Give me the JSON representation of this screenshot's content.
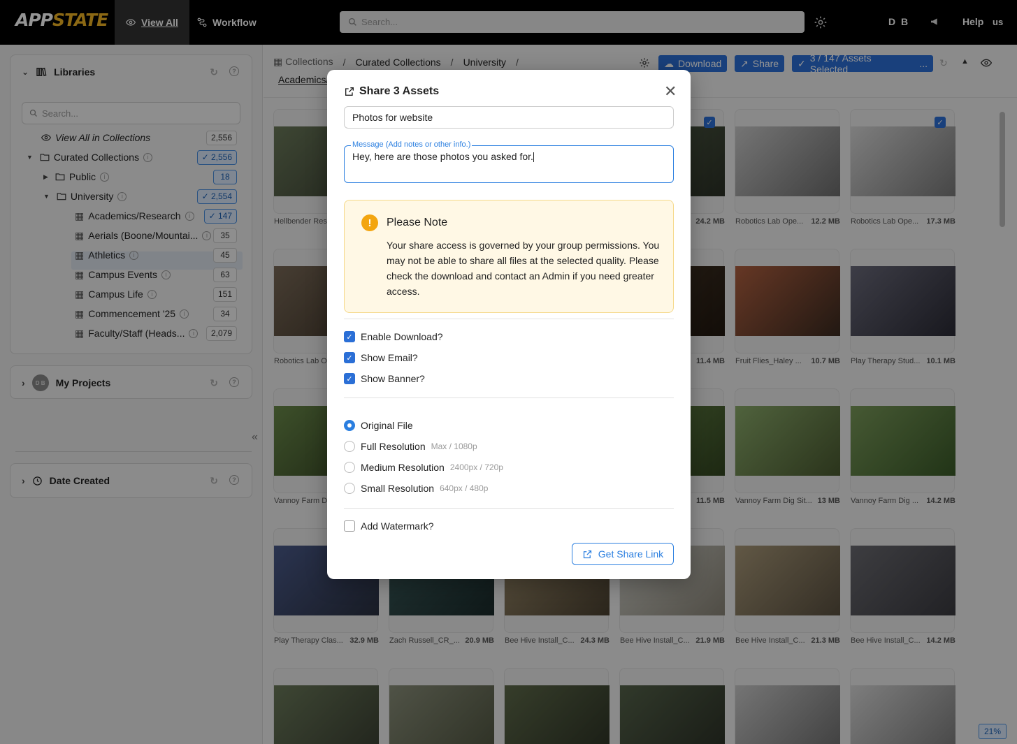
{
  "header": {
    "logo_text_white": "APP",
    "logo_text_gold": "STATE",
    "nav_view_all": "View All",
    "nav_workflow": "Workflow",
    "search_placeholder": "Search...",
    "user_initials": "D B",
    "help": "Help",
    "lang": "us"
  },
  "sidebar": {
    "libraries_title": "Libraries",
    "search_placeholder": "Search...",
    "tree": [
      {
        "label": "View All in Collections",
        "count": "2,556"
      },
      {
        "label": "Curated Collections",
        "count": "2,556"
      },
      {
        "label": "Public",
        "count": "18"
      },
      {
        "label": "University",
        "count": "2,554"
      },
      {
        "label": "Academics/Research",
        "count": "147"
      },
      {
        "label": "Aerials (Boone/Mountai...",
        "count": "35"
      },
      {
        "label": "Athletics",
        "count": "45"
      },
      {
        "label": "Campus Events",
        "count": "63"
      },
      {
        "label": "Campus Life",
        "count": "151"
      },
      {
        "label": "Commencement '25",
        "count": "34"
      },
      {
        "label": "Faculty/Staff (Heads...",
        "count": "2,079"
      }
    ],
    "projects_avatar": "D B",
    "projects_title": "My Projects",
    "date_title": "Date Created"
  },
  "toolbar": {
    "crumbs": [
      "Collections",
      "Curated Collections",
      "University"
    ],
    "crumb_current": "Academics/",
    "download": "Download",
    "share": "Share",
    "selected": "3 / 147 Assets Selected",
    "selected_more": "..."
  },
  "assets": [
    {
      "name": "Hellbender Res",
      "size": ""
    },
    {
      "name": "",
      "size": ""
    },
    {
      "name": "",
      "size": ""
    },
    {
      "name": "",
      "size": "24.2 MB"
    },
    {
      "name": "Robotics Lab Ope...",
      "size": "12.2 MB"
    },
    {
      "name": "Robotics Lab Ope...",
      "size": "17.3 MB"
    },
    {
      "name": "Robotics Lab O",
      "size": ""
    },
    {
      "name": "",
      "size": ""
    },
    {
      "name": "",
      "size": ""
    },
    {
      "name": "",
      "size": "11.4 MB"
    },
    {
      "name": "Fruit Flies_Haley ...",
      "size": "10.7 MB"
    },
    {
      "name": "Play Therapy Stud...",
      "size": "10.1 MB"
    },
    {
      "name": "Vannoy Farm D",
      "size": ""
    },
    {
      "name": "",
      "size": ""
    },
    {
      "name": "",
      "size": ""
    },
    {
      "name": "",
      "size": "11.5 MB"
    },
    {
      "name": "Vannoy Farm Dig Sit...",
      "size": "13 MB"
    },
    {
      "name": "Vannoy Farm Dig ...",
      "size": "14.2 MB"
    },
    {
      "name": "Play Therapy Clas...",
      "size": "32.9 MB"
    },
    {
      "name": "Zach Russell_CR_...",
      "size": "20.9 MB"
    },
    {
      "name": "Bee Hive Install_C...",
      "size": "24.3 MB"
    },
    {
      "name": "Bee Hive Install_C...",
      "size": "21.9 MB"
    },
    {
      "name": "Bee Hive Install_C...",
      "size": "21.3 MB"
    },
    {
      "name": "Bee Hive Install_C...",
      "size": "14.2 MB"
    }
  ],
  "zoom": "21%",
  "modal": {
    "title": "Share 3 Assets",
    "subject_value": "Photos for website",
    "message_label": "Message (Add notes or other info.)",
    "message_value": "Hey, here are those photos you asked for.",
    "note_title": "Please Note",
    "note_body": "Your share access is governed by your group permissions. You may not be able to share all files at the selected quality. Please check the download and contact an Admin if you need greater access.",
    "enable_download": "Enable Download?",
    "show_email": "Show Email?",
    "show_banner": "Show Banner?",
    "res_original": "Original File",
    "res_full": "Full Resolution",
    "res_full_hint": "Max / 1080p",
    "res_medium": "Medium Resolution",
    "res_medium_hint": "2400px / 720p",
    "res_small": "Small Resolution",
    "res_small_hint": "640px / 480p",
    "add_watermark": "Add Watermark?",
    "get_link": "Get Share Link"
  },
  "colors": {
    "accent": "#2b6fd6",
    "gold": "#f0b323",
    "note_bg": "#fff8e5",
    "warning": "#f3a50f"
  }
}
